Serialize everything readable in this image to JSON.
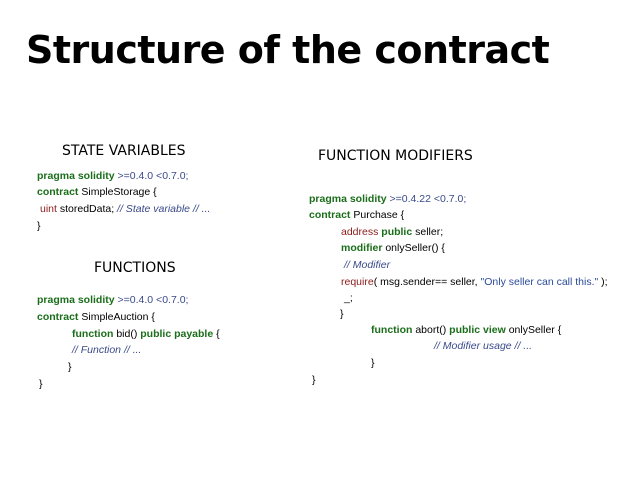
{
  "title": "Structure of the contract",
  "headings": {
    "state_variables": "STATE VARIABLES",
    "functions": "FUNCTIONS",
    "function_modifiers": "FUNCTION MODIFIERS"
  },
  "state_block": {
    "l1_kw": "pragma solidity",
    "l1_ver": " >=0.4.0 <0.7.0;",
    "l2_kw": "contract",
    "l2_rest": " SimpleStorage {",
    "l3_type": "uint",
    "l3_rest": " storedData;",
    "l3_comment": " // State variable // ...",
    "l4": "}"
  },
  "functions_block": {
    "l1_kw": "pragma solidity",
    "l1_ver": " >=0.4.0 <0.7.0;",
    "l2_kw": "contract",
    "l2_rest": " SimpleAuction {",
    "l3_kw1": "function",
    "l3_mid": " bid() ",
    "l3_kw2": "public payable",
    "l3_end": " {",
    "l4_comment": "// Function // ...",
    "l5": "}",
    "l6": "}"
  },
  "modifiers_block": {
    "l1_kw": "pragma solidity",
    "l1_ver": " >=0.4.22 <0.7.0;",
    "l2_kw": "contract",
    "l2_rest": " Purchase {",
    "l3_type": "address",
    "l3_kw": " public",
    "l3_rest": " seller;",
    "l4_kw": "modifier",
    "l4_rest": " onlySeller() {",
    "l5_comment": "// Modifier",
    "l6_type": "require",
    "l6_mid": "( msg.sender== seller, ",
    "l6_str": "\"Only seller can call this.\"",
    "l6_end": " );",
    "l7": "_;",
    "l8": "}",
    "l9_kw1": "function",
    "l9_mid": " abort() ",
    "l9_kw2": "public view",
    "l9_end": " onlySeller {",
    "l10_comment": "// Modifier usage // ...",
    "l11": "}",
    "l12": "}"
  },
  "colors": {
    "keyword": "#1a6e1a",
    "type": "#8b1a1a",
    "comment": "#3a4a8a",
    "string": "#2a4a9a"
  }
}
